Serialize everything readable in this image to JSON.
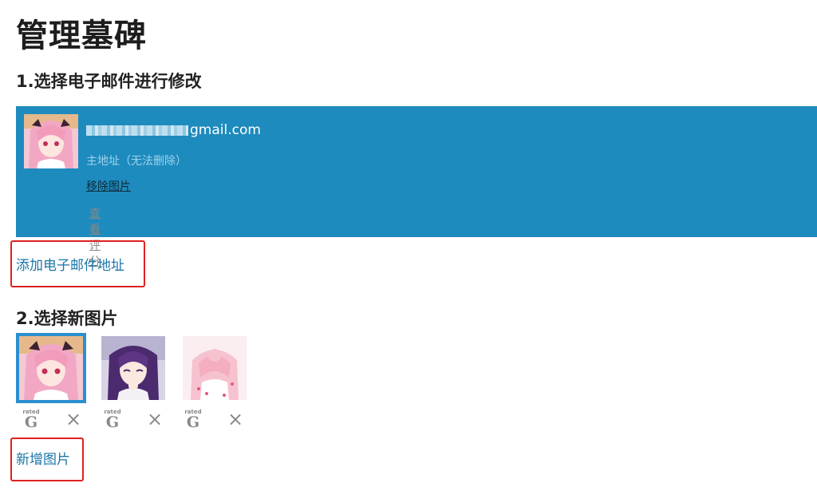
{
  "page": {
    "title": "管理墓碑"
  },
  "section1": {
    "heading": "1.选择电子邮件进行修改"
  },
  "email_card": {
    "address_suffix": "gmail.com",
    "primary_note": "主地址（无法删除）",
    "remove_image": "移除图片",
    "view_rating": "查看评分",
    "bg_color": "#1e8bbe"
  },
  "add_email_link": "添加电子邮件地址",
  "section2": {
    "heading": "2.选择新图片"
  },
  "images": [
    {
      "selected": true,
      "rating_top": "rated",
      "rating": "G",
      "delete_icon": "×"
    },
    {
      "selected": false,
      "rating_top": "rated",
      "rating": "G",
      "delete_icon": "×"
    },
    {
      "selected": false,
      "rating_top": "rated",
      "rating": "G",
      "delete_icon": "×"
    }
  ],
  "add_image_link": "新增图片"
}
